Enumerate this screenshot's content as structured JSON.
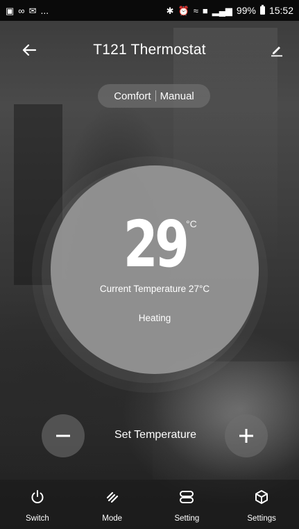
{
  "status_bar": {
    "left_icons": [
      "image-icon",
      "nfc-icon",
      "mail-icon"
    ],
    "ellipsis": "...",
    "battery_percent": "99%",
    "time": "15:52"
  },
  "header": {
    "title": "T121 Thermostat"
  },
  "mode": {
    "comfort_label": "Comfort",
    "manual_label": "Manual"
  },
  "dial": {
    "set_value": "29",
    "unit": "°C",
    "current_temperature": "Current Temperature 27°C",
    "state": "Heating"
  },
  "controls": {
    "set_label": "Set Temperature"
  },
  "nav": {
    "items": [
      {
        "label": "Switch",
        "icon": "power-icon"
      },
      {
        "label": "Mode",
        "icon": "mode-icon"
      },
      {
        "label": "Setting",
        "icon": "setting-icon"
      },
      {
        "label": "Settings",
        "icon": "cube-icon"
      }
    ]
  }
}
